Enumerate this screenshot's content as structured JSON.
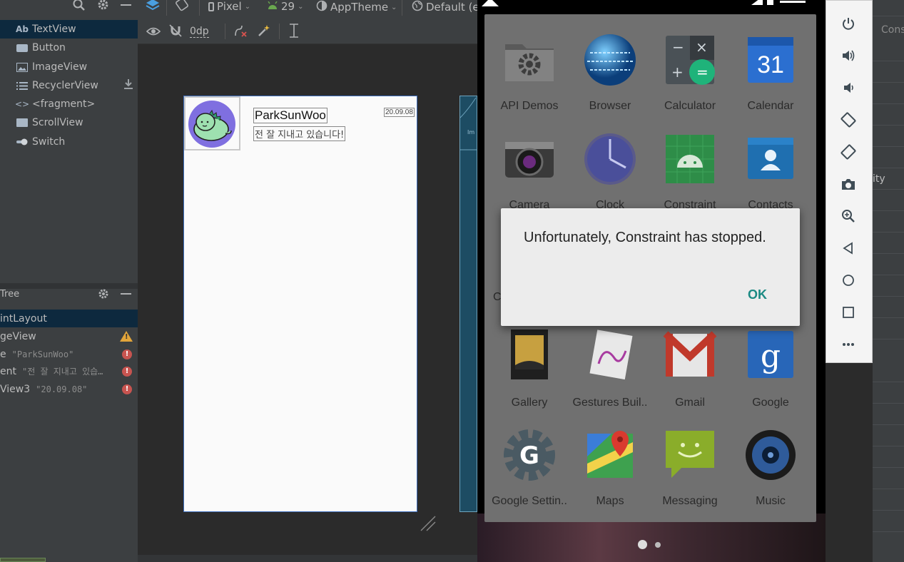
{
  "palette": {
    "items": [
      {
        "icon": "Ab",
        "label": "TextView"
      },
      {
        "icon": "button-icon",
        "label": "Button"
      },
      {
        "icon": "image-icon",
        "label": "ImageView"
      },
      {
        "icon": "list-icon",
        "label": "RecyclerView"
      },
      {
        "icon": "code-icon",
        "label": "<fragment>"
      },
      {
        "icon": "scroll-icon",
        "label": "ScrollView"
      },
      {
        "icon": "switch-icon",
        "label": "Switch"
      }
    ]
  },
  "component_tree": {
    "title": "Tree",
    "rows": [
      {
        "label": "intLayout",
        "sub": "",
        "status": "none"
      },
      {
        "label": "geView",
        "sub": "",
        "status": "warning"
      },
      {
        "label": "e",
        "sub": "\"ParkSunWoo\"",
        "status": "error"
      },
      {
        "label": "ent",
        "sub": "\"전 잘 지내고 있습…",
        "status": "error"
      },
      {
        "label": "View3",
        "sub": "\"20.09.08\"",
        "status": "error"
      }
    ]
  },
  "toolbar": {
    "device": "Pixel",
    "api": "29",
    "theme": "AppTheme",
    "locale": "Default (e",
    "margin": "0dp"
  },
  "design": {
    "name": "ParkSunWoo",
    "message": "전 잘 지내고 있습니다!",
    "date": "20.09.08"
  },
  "emulator": {
    "apps": [
      {
        "label": "API Demos",
        "icon": "folder-gear-icon"
      },
      {
        "label": "Browser",
        "icon": "globe-icon"
      },
      {
        "label": "Calculator",
        "icon": "calculator-icon"
      },
      {
        "label": "Calendar",
        "icon": "calendar-icon",
        "day": "31"
      },
      {
        "label": "Camera",
        "icon": "camera-icon"
      },
      {
        "label": "Clock",
        "icon": "clock-icon"
      },
      {
        "label": "Constraint",
        "icon": "android-icon"
      },
      {
        "label": "Contacts",
        "icon": "contacts-icon"
      },
      {
        "label": "Gallery",
        "icon": "gallery-icon"
      },
      {
        "label": "Gestures Buil..",
        "icon": "gestures-icon"
      },
      {
        "label": "Gmail",
        "icon": "gmail-icon"
      },
      {
        "label": "Google",
        "icon": "google-icon"
      },
      {
        "label": "Google Settin..",
        "icon": "google-settings-icon"
      },
      {
        "label": "Maps",
        "icon": "maps-icon"
      },
      {
        "label": "Messaging",
        "icon": "messaging-icon"
      },
      {
        "label": "Music",
        "icon": "music-icon"
      }
    ],
    "partial_label": "C",
    "dialog": {
      "message": "Unfortunately, Constraint has stopped.",
      "ok": "OK"
    }
  },
  "right_panel": {
    "top_label": "Cons",
    "mid_label": "ity"
  }
}
